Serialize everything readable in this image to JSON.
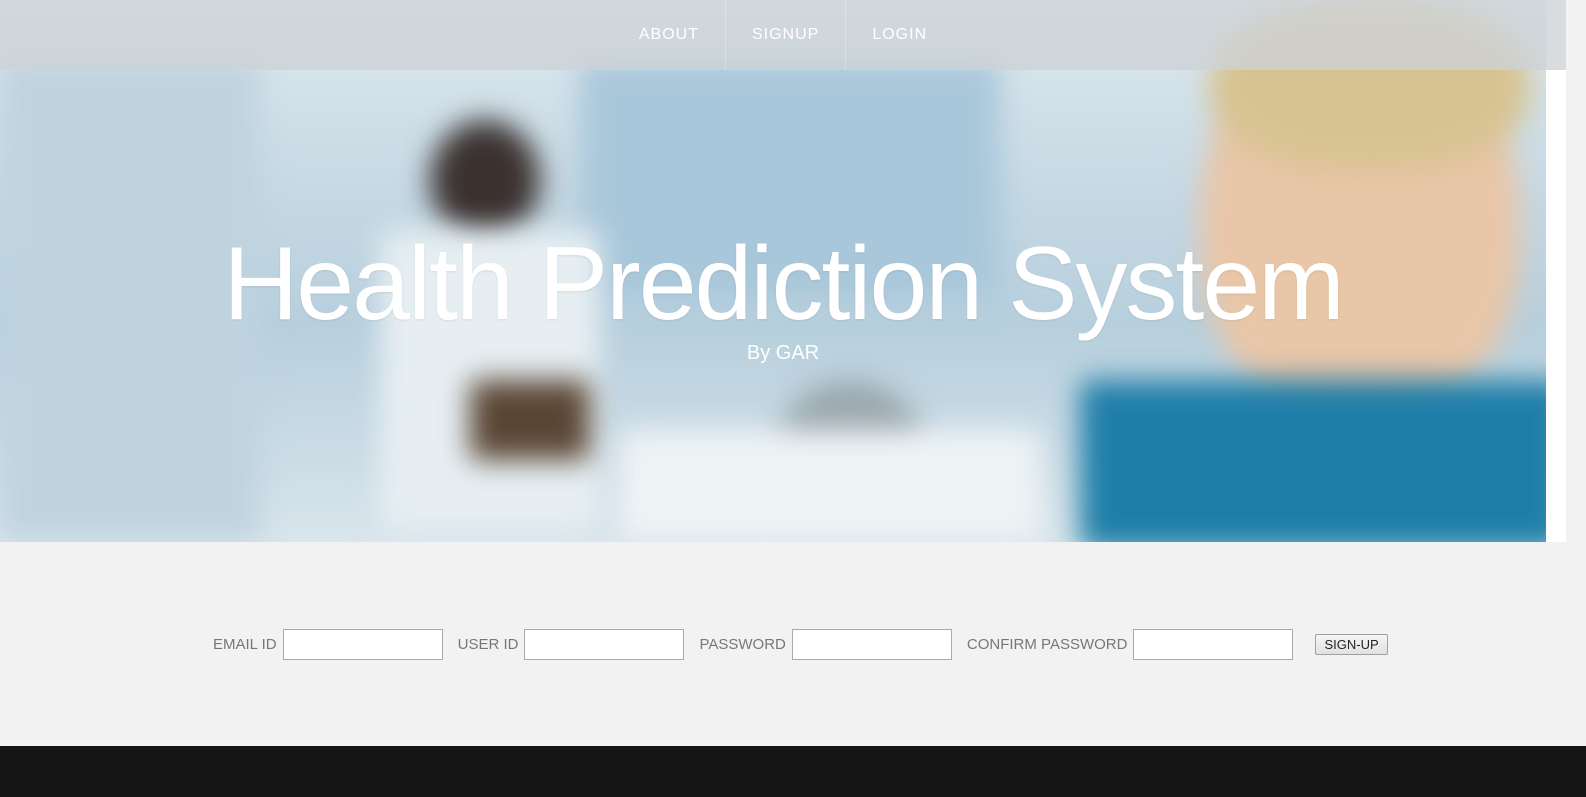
{
  "nav": {
    "items": [
      {
        "label": "ABOUT"
      },
      {
        "label": "SIGNUP"
      },
      {
        "label": "LOGIN"
      }
    ]
  },
  "hero": {
    "title": "Health Prediction System",
    "subtitle": "By GAR"
  },
  "signup_form": {
    "email_label": "EMAIL ID",
    "email_value": "",
    "user_label": "USER ID",
    "user_value": "",
    "password_label": "PASSWORD",
    "password_value": "",
    "confirm_label": "CONFIRM PASSWORD",
    "confirm_value": "",
    "submit_label": "SIGN-UP"
  },
  "colors": {
    "nav_bg": "#cdd2d6",
    "hero_text": "#ffffff",
    "section_bg": "#f2f2f2",
    "footer_bg": "#141414",
    "label_text": "#777777"
  }
}
